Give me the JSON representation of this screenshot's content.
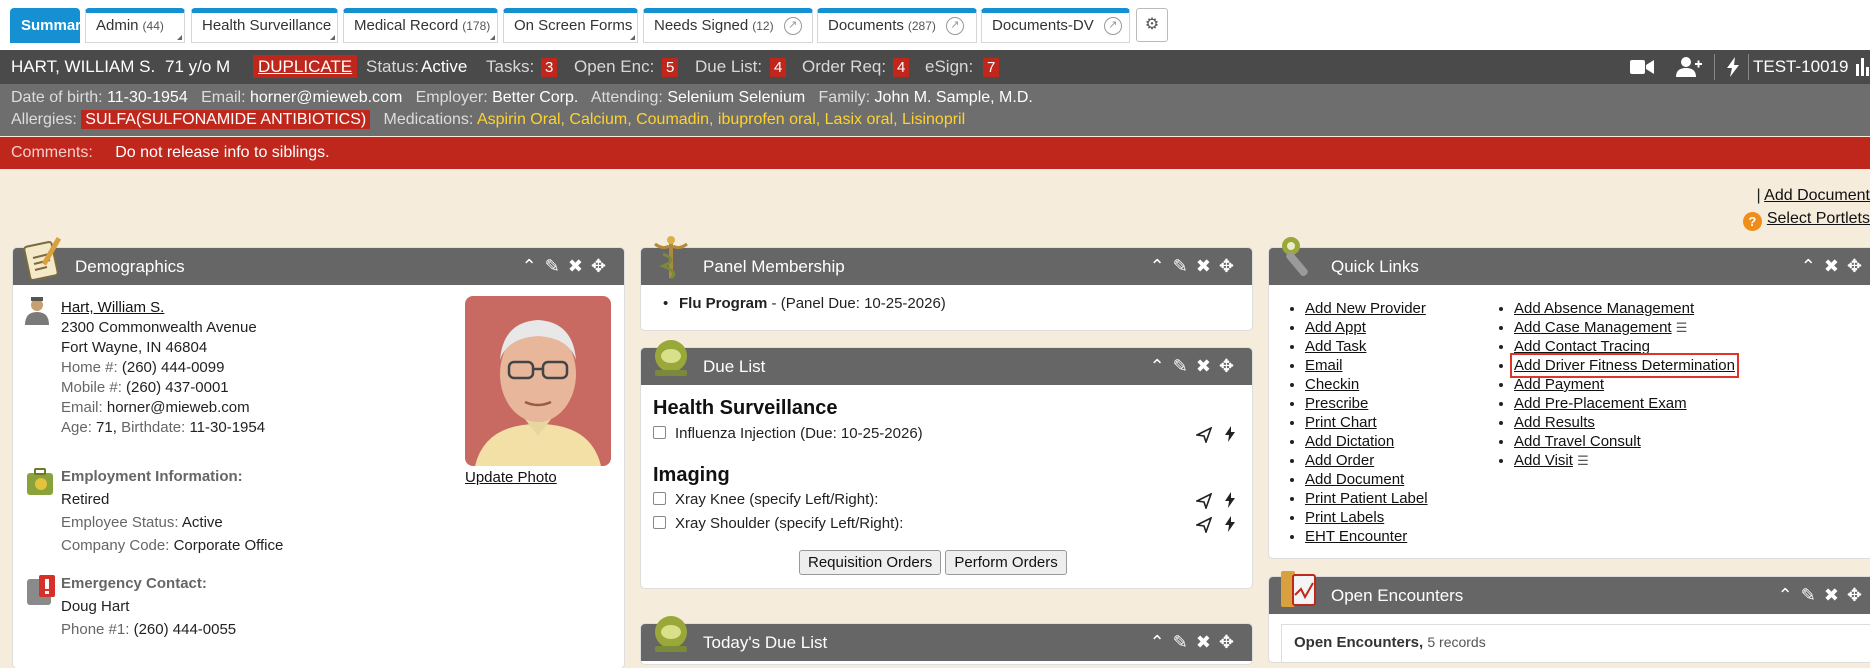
{
  "tabs": [
    {
      "label": "Summary",
      "count": "",
      "active": true
    },
    {
      "label": "Admin",
      "count": "(44)"
    },
    {
      "label": "Health Surveillance",
      "count": ""
    },
    {
      "label": "Medical Record",
      "count": "(178)"
    },
    {
      "label": "On Screen Forms",
      "count": ""
    },
    {
      "label": "Needs Signed",
      "count": "(12)"
    },
    {
      "label": "Documents",
      "count": "(287)"
    },
    {
      "label": "Documents-DV",
      "count": ""
    }
  ],
  "patient": {
    "name": "HART, WILLIAM S.",
    "age_sex": "71 y/o M",
    "duplicate": "DUPLICATE",
    "status_label": "Status:",
    "status": "Active",
    "tasks_label": "Tasks:",
    "tasks": "3",
    "open_enc_label": "Open Enc:",
    "open_enc": "5",
    "due_list_label": "Due List:",
    "due_list": "4",
    "order_req_label": "Order Req:",
    "order_req": "4",
    "esign_label": "eSign:",
    "esign": "7",
    "patient_id": "TEST-10019",
    "dob_label": "Date of birth:",
    "dob": "11-30-1954",
    "email_label": "Email:",
    "email": "horner@mieweb.com",
    "employer_label": "Employer:",
    "employer": "Better Corp.",
    "attending_label": "Attending:",
    "attending": "Selenium Selenium",
    "family_label": "Family:",
    "family": "John M. Sample, M.D.",
    "allergies_label": "Allergies:",
    "allergy": "SULFA(SULFONAMIDE ANTIBIOTICS)",
    "medications_label": "Medications:",
    "medications": "Aspirin Oral, Calcium, Coumadin, ibuprofen oral, Lasix oral, Lisinopril",
    "comments_label": "Comments:",
    "comments": "Do not release info to siblings."
  },
  "toplinks": {
    "add_document": "Add Document",
    "select_portlets": "Select Portlets"
  },
  "demographics": {
    "title": "Demographics",
    "name_link": "Hart, William S.",
    "address1": "2300 Commonwealth Avenue",
    "address2": "Fort Wayne, IN 46804",
    "home_label": "Home #:",
    "home": "(260) 444-0099",
    "mobile_label": "Mobile #:",
    "mobile": "(260) 437-0001",
    "email_label": "Email:",
    "email": "horner@mieweb.com",
    "age_label": "Age:",
    "age": "71",
    "birthdate_label": "Birthdate:",
    "birthdate": "11-30-1954",
    "update_photo": "Update Photo",
    "employment_heading": "Employment Information:",
    "employment_status": "Retired",
    "employee_status_label": "Employee Status:",
    "employee_status": "Active",
    "company_code_label": "Company Code:",
    "company_code": "Corporate Office",
    "emergency_heading": "Emergency Contact:",
    "emergency_name": "Doug Hart",
    "phone1_label": "Phone #1:",
    "phone1": "(260) 444-0055"
  },
  "panel": {
    "title": "Panel Membership",
    "program": "Flu Program",
    "due": "- (Panel Due: 10-25-2026)"
  },
  "due_list": {
    "title": "Due List",
    "section1": "Health Surveillance",
    "item1": "Influenza Injection (Due: 10-25-2026)",
    "section2": "Imaging",
    "item2": "Xray Knee (specify Left/Right):",
    "item3": "Xray Shoulder (specify Left/Right):",
    "requisition_btn": "Requisition Orders",
    "perform_btn": "Perform Orders"
  },
  "todays_due": {
    "title": "Today's Due List"
  },
  "quick_links": {
    "title": "Quick Links",
    "col1": [
      "Add New Provider",
      "Add Appt",
      "Add Task",
      "Email",
      "Checkin",
      "Prescribe",
      "Print Chart",
      "Add Dictation",
      "Add Order",
      "Add Document",
      "Print Patient Label",
      "Print Labels",
      "EHT Encounter"
    ],
    "col2": [
      "Add Absence Management",
      "Add Case Management",
      "Add Contact Tracing",
      "Add Driver Fitness Determination",
      "Add Payment",
      "Add Pre-Placement Exam",
      "Add Results",
      "Add Travel Consult",
      "Add Visit"
    ]
  },
  "open_encounters": {
    "title": "Open Encounters",
    "heading": "Open Encounters,",
    "records": "5 records"
  }
}
